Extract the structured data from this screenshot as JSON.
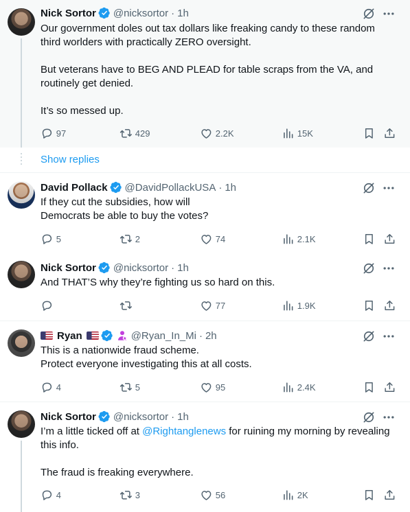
{
  "posts": [
    {
      "name": "Nick Sortor",
      "handle": "@nicksortor",
      "time": "1h",
      "text": "Our government doles out tax dollars like freaking candy to these random third worlders with practically ZERO oversight.\n\nBut veterans have to BEG AND PLEAD for table scraps from the VA, and routinely get denied.\n\nIt’s so messed up.",
      "replies": "97",
      "reposts": "429",
      "likes": "2.2K",
      "views": "15K"
    },
    {
      "name": "David Pollack",
      "handle": "@DavidPollackUSA",
      "time": "1h",
      "text": "If they cut the subsidies, how will\nDemocrats be able to buy the votes?",
      "replies": "5",
      "reposts": "2",
      "likes": "74",
      "views": "2.1K"
    },
    {
      "name": "Nick Sortor",
      "handle": "@nicksortor",
      "time": "1h",
      "text": "And THAT’S why they’re fighting us so hard on this.",
      "replies": "",
      "reposts": "",
      "likes": "77",
      "views": "1.9K"
    },
    {
      "name": "Ryan",
      "handle": "@Ryan_In_Mi",
      "time": "2h",
      "text": "This is a nationwide fraud scheme.\nProtect everyone investigating this at all costs.",
      "replies": "4",
      "reposts": "5",
      "likes": "95",
      "views": "2.4K"
    },
    {
      "name": "Nick Sortor",
      "handle": "@nicksortor",
      "time": "1h",
      "text_before": "I’m a little ticked off at ",
      "mention": "@Rightanglenews",
      "text_after": " for ruining my morning by revealing this info.\n\nThe fraud is freaking everywhere.",
      "replies": "4",
      "reposts": "3",
      "likes": "56",
      "views": "2K"
    }
  ],
  "show_replies": "Show replies",
  "separator": "·",
  "colors": {
    "accent": "#1d9bf0",
    "muted": "#536471",
    "text": "#0f1419",
    "thread_line": "#cfd9de",
    "highlight_bg": "#f7f9f9",
    "badge_purple": "#c13fdc"
  },
  "icons": [
    "verified-badge-icon",
    "grok-icon",
    "more-icon",
    "reply-icon",
    "retweet-icon",
    "like-icon",
    "views-icon",
    "bookmark-icon",
    "share-icon",
    "us-flag-icon",
    "person-badge-icon"
  ]
}
